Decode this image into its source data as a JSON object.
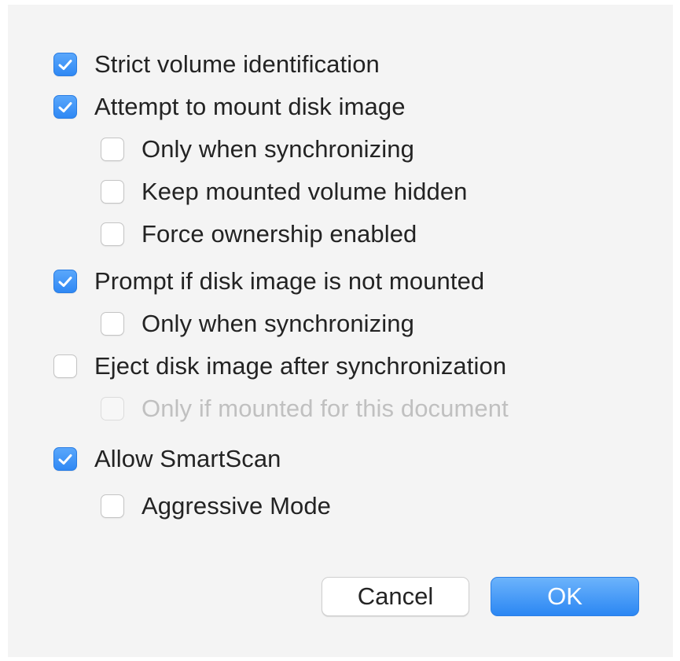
{
  "options": [
    {
      "label": "Strict volume identification",
      "checked": true,
      "disabled": false
    },
    {
      "label": "Attempt to mount disk image",
      "checked": true,
      "disabled": false
    },
    {
      "label": "Only when synchronizing",
      "checked": false,
      "disabled": false
    },
    {
      "label": "Keep mounted volume hidden",
      "checked": false,
      "disabled": false
    },
    {
      "label": "Force ownership enabled",
      "checked": false,
      "disabled": false
    },
    {
      "label": "Prompt if disk image is not mounted",
      "checked": true,
      "disabled": false
    },
    {
      "label": "Only when synchronizing",
      "checked": false,
      "disabled": false
    },
    {
      "label": "Eject disk image after synchronization",
      "checked": false,
      "disabled": false
    },
    {
      "label": "Only if mounted for this document",
      "checked": false,
      "disabled": true
    },
    {
      "label": "Allow SmartScan",
      "checked": true,
      "disabled": false
    },
    {
      "label": "Aggressive Mode",
      "checked": false,
      "disabled": false
    }
  ],
  "buttons": {
    "cancel_label": "Cancel",
    "ok_label": "OK"
  },
  "colors": {
    "accent": "#2f88f4",
    "background": "#f4f4f4"
  }
}
